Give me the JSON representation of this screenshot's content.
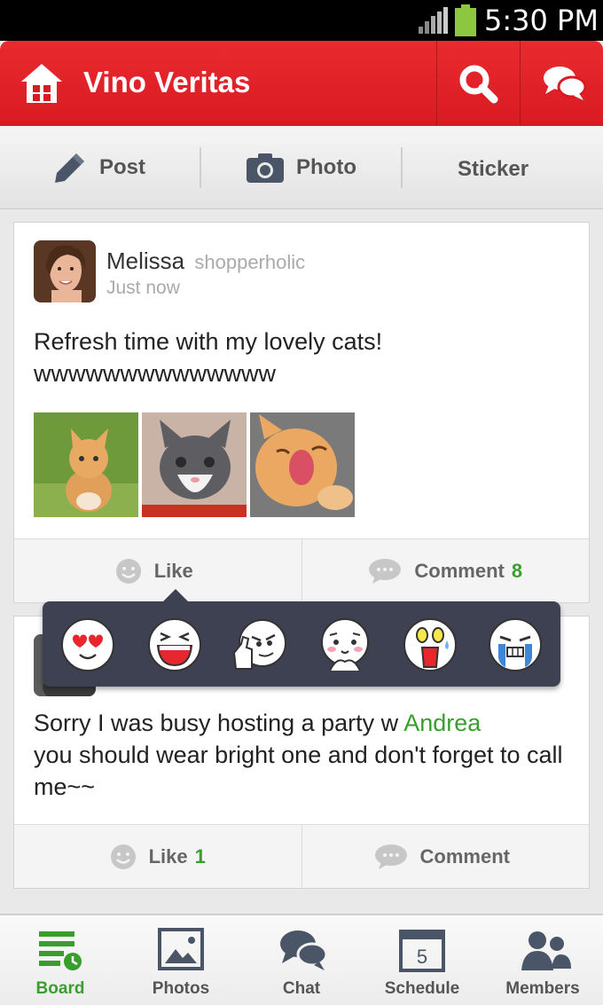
{
  "status_bar": {
    "time": "5:30 PM"
  },
  "header": {
    "title": "Vino Veritas"
  },
  "toolbar": {
    "post": "Post",
    "photo": "Photo",
    "sticker": "Sticker"
  },
  "posts": [
    {
      "author": "Melissa",
      "tagline": "shopperholic",
      "time": "Just now",
      "text_line1": "Refresh time with my lovely cats!",
      "text_line2": "wwwwwwwwwwwwww",
      "like_label": "Like",
      "like_count": "",
      "comment_label": "Comment",
      "comment_count": "8"
    },
    {
      "text_part1": "Sorry I was busy hosting a party w ",
      "mention": "Andrea",
      "text_part2": "you should wear bright one and don't forget to call me~~",
      "like_label": "Like",
      "like_count": "1",
      "comment_label": "Comment",
      "comment_count": ""
    }
  ],
  "sticker_popup": {
    "stickers": [
      "heart-eyes-sticker",
      "laughing-sticker",
      "thumbs-up-sticker",
      "shy-sticker",
      "shocked-sticker",
      "crying-sticker"
    ]
  },
  "bottom_nav": [
    {
      "label": "Board",
      "active": true
    },
    {
      "label": "Photos",
      "active": false
    },
    {
      "label": "Chat",
      "active": false
    },
    {
      "label": "Schedule",
      "active": false,
      "badge": "5"
    },
    {
      "label": "Members",
      "active": false
    }
  ],
  "colors": {
    "header": "#d81b22",
    "accent_green": "#3a9e2f",
    "popup": "#3e4151"
  }
}
